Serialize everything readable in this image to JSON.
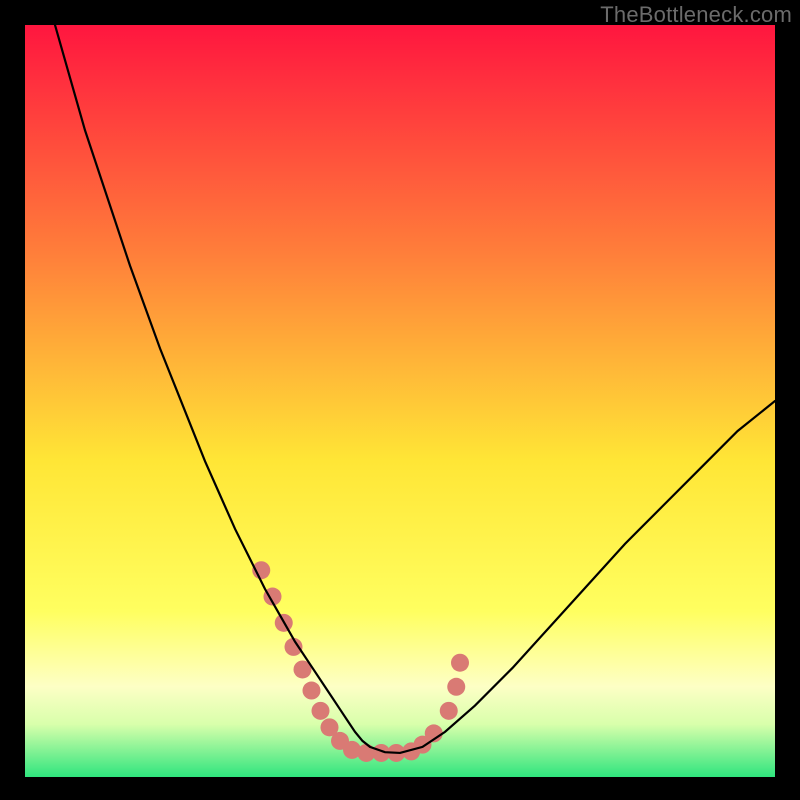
{
  "watermark": "TheBottleneck.com",
  "colors": {
    "page_bg": "#000000",
    "gradient_top": "#ff163f",
    "gradient_mid_upper": "#ff7d3a",
    "gradient_mid": "#ffe636",
    "gradient_lower": "#ffff60",
    "gradient_band_pale": "#fdffc5",
    "gradient_bottom": "#2fe57e",
    "curve": "#000000",
    "marker": "#d97a74"
  },
  "chart_data": {
    "type": "line",
    "title": "",
    "xlabel": "",
    "ylabel": "",
    "xlim": [
      0,
      100
    ],
    "ylim": [
      0,
      100
    ],
    "grid": false,
    "legend": false,
    "series": [
      {
        "name": "bottleneck-curve",
        "x": [
          4,
          6,
          8,
          10,
          12,
          14,
          16,
          18,
          20,
          22,
          24,
          26,
          28,
          30,
          32,
          34,
          36,
          38,
          40,
          41,
          42,
          43,
          44,
          45,
          46,
          48,
          50,
          53,
          56,
          60,
          65,
          70,
          75,
          80,
          85,
          90,
          95,
          100
        ],
        "y": [
          100,
          93,
          86,
          80,
          74,
          68,
          62.5,
          57,
          52,
          47,
          42,
          37.5,
          33,
          29,
          25,
          21.5,
          18,
          15,
          12,
          10.5,
          9,
          7.5,
          6,
          4.8,
          4,
          3.3,
          3.2,
          4,
          6,
          9.5,
          14.5,
          20,
          25.5,
          31,
          36,
          41,
          46,
          50
        ]
      }
    ],
    "markers": [
      {
        "x": 31.5,
        "y": 27.5
      },
      {
        "x": 33.0,
        "y": 24.0
      },
      {
        "x": 34.5,
        "y": 20.5
      },
      {
        "x": 35.8,
        "y": 17.3
      },
      {
        "x": 37.0,
        "y": 14.3
      },
      {
        "x": 38.2,
        "y": 11.5
      },
      {
        "x": 39.4,
        "y": 8.8
      },
      {
        "x": 40.6,
        "y": 6.6
      },
      {
        "x": 42.0,
        "y": 4.8
      },
      {
        "x": 43.6,
        "y": 3.6
      },
      {
        "x": 45.5,
        "y": 3.2
      },
      {
        "x": 47.5,
        "y": 3.2
      },
      {
        "x": 49.5,
        "y": 3.2
      },
      {
        "x": 51.5,
        "y": 3.4
      },
      {
        "x": 53.0,
        "y": 4.3
      },
      {
        "x": 54.5,
        "y": 5.8
      },
      {
        "x": 56.5,
        "y": 8.8
      },
      {
        "x": 57.5,
        "y": 12.0
      },
      {
        "x": 58.0,
        "y": 15.2
      }
    ],
    "marker_radius_px": 9
  }
}
